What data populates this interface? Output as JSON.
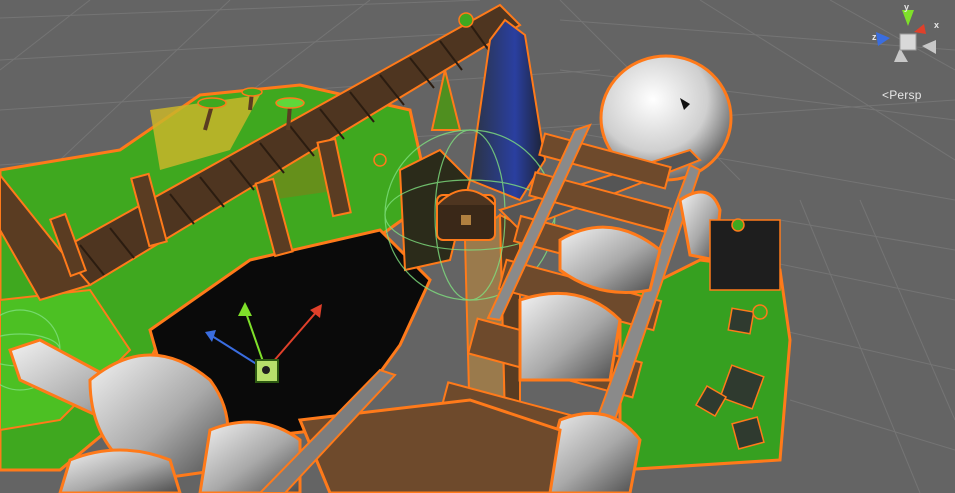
{
  "scene_view": {
    "projection_label": "Persp",
    "gizmo_axes": {
      "x": "x",
      "y": "y",
      "z": "z"
    },
    "colors": {
      "background": "#646464",
      "grid": "#7a7a7a",
      "selection_outline": "#ff7a1a",
      "terrain_green": "#3fa81f",
      "wood": "#6e4a2c",
      "wood_dark": "#3f2a19",
      "rock_grey": "#9a9a9a",
      "gizmo_x": "#e0402a",
      "gizmo_y": "#7fe02a",
      "gizmo_z": "#3a6de0",
      "collider_green": "#7fe07f"
    }
  }
}
